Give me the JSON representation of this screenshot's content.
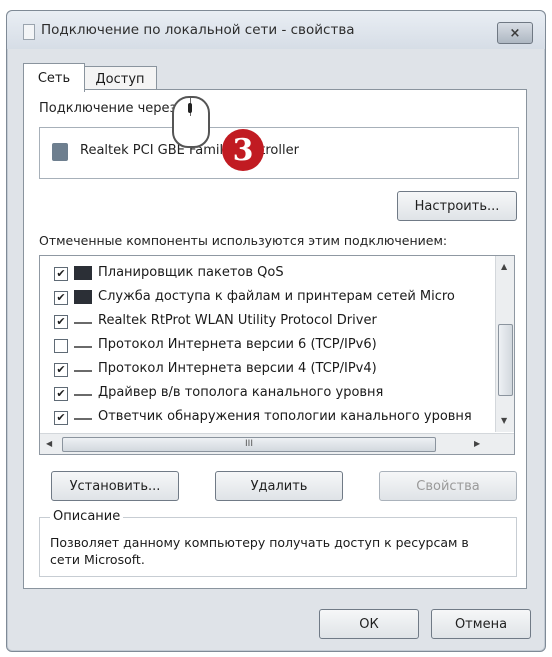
{
  "window": {
    "title": "Подключение по локальной сети - свойства",
    "close_label": "×"
  },
  "tabs": [
    {
      "label": "Сеть",
      "active": true
    },
    {
      "label": "Доступ",
      "active": false
    }
  ],
  "connection": {
    "label": "Подключение через:",
    "adapter_name": "Realtek PCI GBE Family Controller",
    "configure_label": "Настроить..."
  },
  "components": {
    "label": "Отмеченные компоненты используются этим подключением:",
    "items": [
      {
        "label": "Планировщик пакетов QoS",
        "checked": true,
        "icon": "qos-icon"
      },
      {
        "label": "Служба доступа к файлам и принтерам сетей Micro",
        "checked": true,
        "icon": "file-share-icon"
      },
      {
        "label": "Realtek RtProt WLAN Utility Protocol Driver",
        "checked": true,
        "icon": "protocol-icon"
      },
      {
        "label": "Протокол Интернета версии 6 (TCP/IPv6)",
        "checked": false,
        "icon": "protocol-icon"
      },
      {
        "label": "Протокол Интернета версии 4 (TCP/IPv4)",
        "checked": true,
        "icon": "protocol-icon"
      },
      {
        "label": "Драйвер в/в тополога канального уровня",
        "checked": true,
        "icon": "protocol-icon"
      },
      {
        "label": "Ответчик обнаружения топологии канального уровня",
        "checked": true,
        "icon": "protocol-icon"
      }
    ],
    "hscroll_label": "III"
  },
  "buttons": {
    "install_label": "Установить...",
    "remove_label": "Удалить",
    "properties_label": "Свойства",
    "ok_label": "ОК",
    "cancel_label": "Отмена"
  },
  "description": {
    "title": "Описание",
    "text": "Позволяет данному компьютеру получать доступ к ресурсам в сети Microsoft."
  },
  "annotation": {
    "step_number": "3"
  },
  "colors": {
    "badge": "#c11b22",
    "window_bg": "#dfe3e8"
  }
}
